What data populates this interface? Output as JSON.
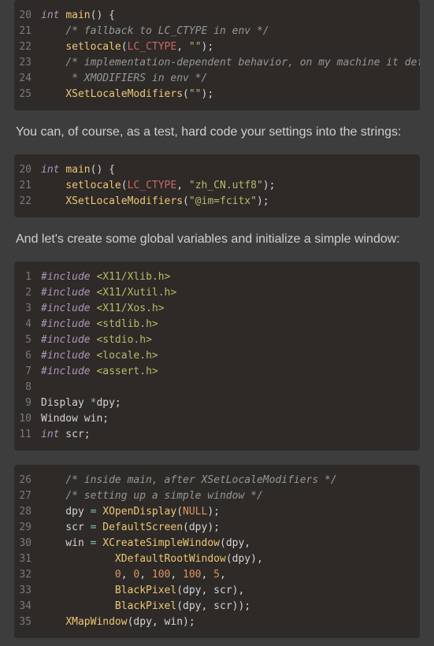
{
  "blocks": [
    {
      "type": "code",
      "lines": [
        {
          "n": "20",
          "tokens": [
            [
              "kw",
              "int"
            ],
            [
              "ty",
              " "
            ],
            [
              "fn",
              "main"
            ],
            [
              "ty",
              "() {"
            ]
          ]
        },
        {
          "n": "21",
          "tokens": [
            [
              "ty",
              "    "
            ],
            [
              "cmt",
              "/* fallback to LC_CTYPE in env */"
            ]
          ]
        },
        {
          "n": "22",
          "tokens": [
            [
              "ty",
              "    "
            ],
            [
              "fn",
              "setlocale"
            ],
            [
              "ty",
              "("
            ],
            [
              "id",
              "LC_CTYPE"
            ],
            [
              "ty",
              ", "
            ],
            [
              "str",
              "\"\""
            ],
            [
              "ty",
              ");"
            ]
          ]
        },
        {
          "n": "23",
          "tokens": [
            [
              "ty",
              "    "
            ],
            [
              "cmt",
              "/* implementation-dependent behavior, on my machine it defaul"
            ]
          ]
        },
        {
          "n": "24",
          "tokens": [
            [
              "ty",
              "    "
            ],
            [
              "cmt",
              " * XMODIFIERS in env */"
            ]
          ]
        },
        {
          "n": "25",
          "tokens": [
            [
              "ty",
              "    "
            ],
            [
              "fn",
              "XSetLocaleModifiers"
            ],
            [
              "ty",
              "("
            ],
            [
              "str",
              "\"\""
            ],
            [
              "ty",
              ");"
            ]
          ]
        }
      ]
    },
    {
      "type": "prose",
      "text": "You can, of course, as a test, hard code your settings into the strings:"
    },
    {
      "type": "code",
      "lines": [
        {
          "n": "20",
          "tokens": [
            [
              "kw",
              "int"
            ],
            [
              "ty",
              " "
            ],
            [
              "fn",
              "main"
            ],
            [
              "ty",
              "() {"
            ]
          ]
        },
        {
          "n": "21",
          "tokens": [
            [
              "ty",
              "    "
            ],
            [
              "fn",
              "setlocale"
            ],
            [
              "ty",
              "("
            ],
            [
              "id",
              "LC_CTYPE"
            ],
            [
              "ty",
              ", "
            ],
            [
              "str",
              "\"zh_CN.utf8\""
            ],
            [
              "ty",
              ");"
            ]
          ]
        },
        {
          "n": "22",
          "tokens": [
            [
              "ty",
              "    "
            ],
            [
              "fn",
              "XSetLocaleModifiers"
            ],
            [
              "ty",
              "("
            ],
            [
              "str",
              "\"@im=fcitx\""
            ],
            [
              "ty",
              ");"
            ]
          ]
        }
      ]
    },
    {
      "type": "prose",
      "text": "And let's create some global variables and initialize a simple window:"
    },
    {
      "type": "code",
      "lines": [
        {
          "n": "1",
          "tokens": [
            [
              "kw",
              "#include"
            ],
            [
              "ty",
              " "
            ],
            [
              "inc",
              "<X11/Xlib.h>"
            ]
          ]
        },
        {
          "n": "2",
          "tokens": [
            [
              "kw",
              "#include"
            ],
            [
              "ty",
              " "
            ],
            [
              "inc",
              "<X11/Xutil.h>"
            ]
          ]
        },
        {
          "n": "3",
          "tokens": [
            [
              "kw",
              "#include"
            ],
            [
              "ty",
              " "
            ],
            [
              "inc",
              "<X11/Xos.h>"
            ]
          ]
        },
        {
          "n": "4",
          "tokens": [
            [
              "kw",
              "#include"
            ],
            [
              "ty",
              " "
            ],
            [
              "inc",
              "<stdlib.h>"
            ]
          ]
        },
        {
          "n": "5",
          "tokens": [
            [
              "kw",
              "#include"
            ],
            [
              "ty",
              " "
            ],
            [
              "inc",
              "<stdio.h>"
            ]
          ]
        },
        {
          "n": "6",
          "tokens": [
            [
              "kw",
              "#include"
            ],
            [
              "ty",
              " "
            ],
            [
              "inc",
              "<locale.h>"
            ]
          ]
        },
        {
          "n": "7",
          "tokens": [
            [
              "kw",
              "#include"
            ],
            [
              "ty",
              " "
            ],
            [
              "inc",
              "<assert.h>"
            ]
          ]
        },
        {
          "n": "8",
          "tokens": [
            [
              "ty",
              ""
            ]
          ]
        },
        {
          "n": "9",
          "tokens": [
            [
              "ty",
              "Display "
            ],
            [
              "star",
              "*"
            ],
            [
              "ty",
              "dpy;"
            ]
          ]
        },
        {
          "n": "10",
          "tokens": [
            [
              "ty",
              "Window win;"
            ]
          ]
        },
        {
          "n": "11",
          "tokens": [
            [
              "kw",
              "int"
            ],
            [
              "ty",
              " scr;"
            ]
          ]
        }
      ]
    },
    {
      "type": "code",
      "lines": [
        {
          "n": "26",
          "tokens": [
            [
              "ty",
              "    "
            ],
            [
              "cmt",
              "/* inside main, after XSetLocaleModifiers */"
            ]
          ]
        },
        {
          "n": "27",
          "tokens": [
            [
              "ty",
              "    "
            ],
            [
              "cmt",
              "/* setting up a simple window */"
            ]
          ]
        },
        {
          "n": "28",
          "tokens": [
            [
              "ty",
              "    dpy "
            ],
            [
              "op",
              "="
            ],
            [
              "ty",
              " "
            ],
            [
              "fn",
              "XOpenDisplay"
            ],
            [
              "ty",
              "("
            ],
            [
              "num",
              "NULL"
            ],
            [
              "ty",
              ");"
            ]
          ]
        },
        {
          "n": "29",
          "tokens": [
            [
              "ty",
              "    scr "
            ],
            [
              "op",
              "="
            ],
            [
              "ty",
              " "
            ],
            [
              "fn",
              "DefaultScreen"
            ],
            [
              "ty",
              "(dpy);"
            ]
          ]
        },
        {
          "n": "30",
          "tokens": [
            [
              "ty",
              "    win "
            ],
            [
              "op",
              "="
            ],
            [
              "ty",
              " "
            ],
            [
              "fn",
              "XCreateSimpleWindow"
            ],
            [
              "ty",
              "(dpy,"
            ]
          ]
        },
        {
          "n": "31",
          "tokens": [
            [
              "ty",
              "            "
            ],
            [
              "fn",
              "XDefaultRootWindow"
            ],
            [
              "ty",
              "(dpy),"
            ]
          ]
        },
        {
          "n": "32",
          "tokens": [
            [
              "ty",
              "            "
            ],
            [
              "num",
              "0"
            ],
            [
              "ty",
              ", "
            ],
            [
              "num",
              "0"
            ],
            [
              "ty",
              ", "
            ],
            [
              "num",
              "100"
            ],
            [
              "ty",
              ", "
            ],
            [
              "num",
              "100"
            ],
            [
              "ty",
              ", "
            ],
            [
              "num",
              "5"
            ],
            [
              "ty",
              ","
            ]
          ]
        },
        {
          "n": "33",
          "tokens": [
            [
              "ty",
              "            "
            ],
            [
              "fn",
              "BlackPixel"
            ],
            [
              "ty",
              "(dpy, scr),"
            ]
          ]
        },
        {
          "n": "34",
          "tokens": [
            [
              "ty",
              "            "
            ],
            [
              "fn",
              "BlackPixel"
            ],
            [
              "ty",
              "(dpy, scr));"
            ]
          ]
        },
        {
          "n": "35",
          "tokens": [
            [
              "ty",
              "    "
            ],
            [
              "fn",
              "XMapWindow"
            ],
            [
              "ty",
              "(dpy, win);"
            ]
          ]
        }
      ]
    }
  ]
}
